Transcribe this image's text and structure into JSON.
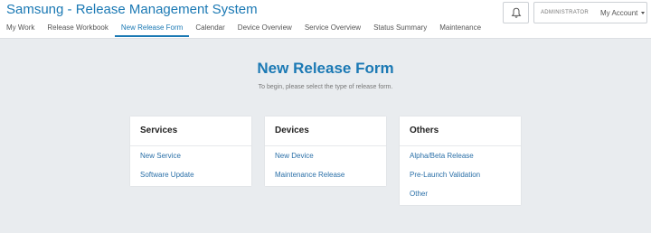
{
  "app": {
    "title": "Samsung - Release Management System"
  },
  "nav": {
    "items": [
      {
        "label": "My Work"
      },
      {
        "label": "Release Workbook"
      },
      {
        "label": "New Release Form"
      },
      {
        "label": "Calendar"
      },
      {
        "label": "Device Overview"
      },
      {
        "label": "Service Overview"
      },
      {
        "label": "Status Summary"
      },
      {
        "label": "Maintenance"
      }
    ],
    "active": "New Release Form"
  },
  "account": {
    "role": "ADMINISTRATOR",
    "menu_label": "My Account"
  },
  "icons": {
    "notifications": "bell-icon",
    "account_menu": "chevron-down-icon"
  },
  "page": {
    "title": "New Release Form",
    "subtitle": "To begin, please select the type of release form."
  },
  "cards": [
    {
      "title": "Services",
      "links": [
        "New Service",
        "Software Update"
      ]
    },
    {
      "title": "Devices",
      "links": [
        "New Device",
        "Maintenance Release"
      ]
    },
    {
      "title": "Others",
      "links": [
        "Alpha/Beta Release",
        "Pre-Launch Validation",
        "Other"
      ]
    }
  ],
  "colors": {
    "accent": "#1b79b4",
    "link": "#2b70a8",
    "background": "#e9ecef"
  }
}
